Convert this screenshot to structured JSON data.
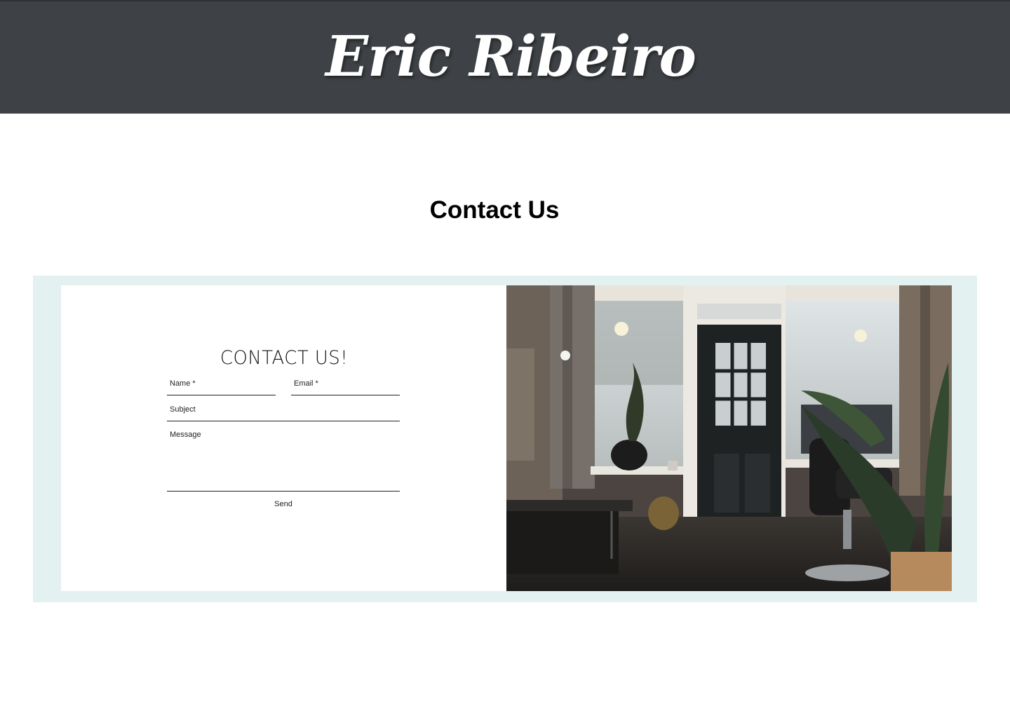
{
  "header": {
    "site_title": "Eric Ribeiro"
  },
  "page": {
    "title": "Contact Us"
  },
  "contact_form": {
    "heading": "CONTACT US!",
    "fields": {
      "name": {
        "label": "Name *"
      },
      "email": {
        "label": "Email *"
      },
      "subject": {
        "label": "Subject"
      },
      "message": {
        "label": "Message"
      }
    },
    "send_label": "Send"
  },
  "colors": {
    "header_bg": "#3e4246",
    "strip_bg": "#e3f1f1",
    "panel_bg": "#ffffff"
  },
  "images": {
    "salon_photo": "salon-interior-photo"
  }
}
